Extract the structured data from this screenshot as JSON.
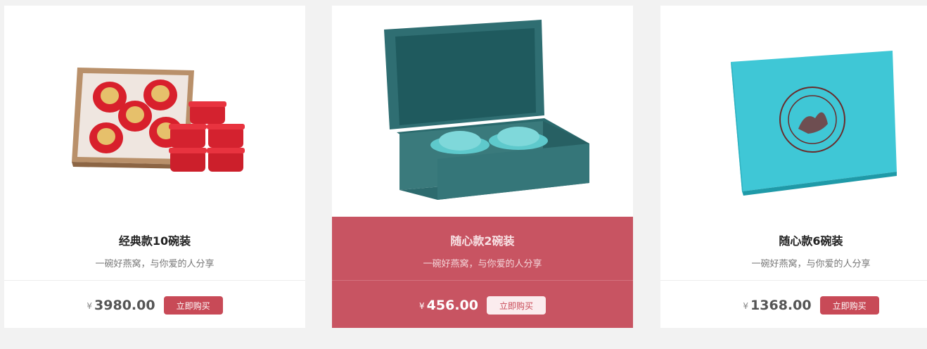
{
  "products": [
    {
      "title": "经典款10碗装",
      "subtitle": "一碗好燕窝，与你爱的人分享",
      "currency": "¥",
      "price": "3980.00",
      "buy_label": "立即购买",
      "image": "red-gift-box-with-bowls"
    },
    {
      "title": "随心款2碗装",
      "subtitle": "一碗好燕窝，与你爱的人分享",
      "currency": "¥",
      "price": "456.00",
      "buy_label": "立即购买",
      "image": "teal-open-box-with-two-bowls",
      "highlighted": true
    },
    {
      "title": "随心款6碗装",
      "subtitle": "一碗好燕窝，与你爱的人分享",
      "currency": "¥",
      "price": "1368.00",
      "buy_label": "立即购买",
      "image": "cyan-gift-box-with-seal"
    }
  ],
  "colors": {
    "accent": "#c84a57",
    "highlight_bg": "#c85462",
    "page_bg": "#f2f2f2"
  }
}
